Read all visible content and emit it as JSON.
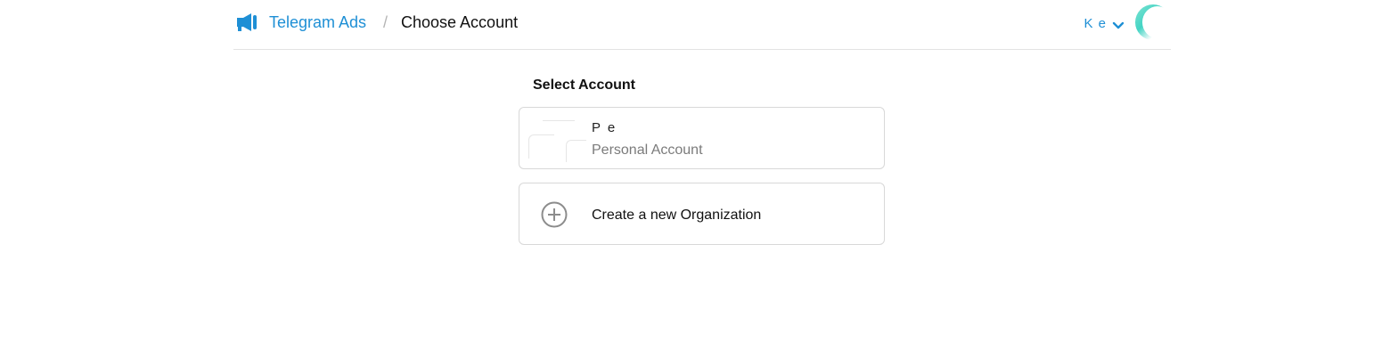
{
  "header": {
    "app_link": "Telegram Ads",
    "separator": "/",
    "current_page": "Choose Account",
    "user": {
      "name": "K  e",
      "chevron_icon": "chevron-down-icon",
      "avatar_icon": "avatar"
    },
    "logo_icon": "megaphone-icon",
    "brand_color": "#1e8fd5"
  },
  "main": {
    "section_title": "Select Account",
    "accounts": [
      {
        "name": "P  e",
        "type": "Personal Account"
      }
    ],
    "create_option": {
      "label": "Create a new Organization",
      "icon": "plus-circle-icon"
    }
  }
}
